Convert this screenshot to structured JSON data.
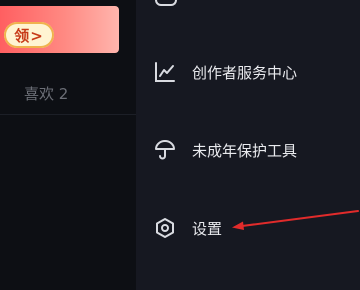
{
  "left_panel": {
    "banner_button_label": "领>",
    "likes_label": "喜欢 2"
  },
  "menu": {
    "items": [
      {
        "label": "创作者服务中心",
        "icon": "chart-icon"
      },
      {
        "label": "未成年保护工具",
        "icon": "umbrella-icon"
      },
      {
        "label": "设置",
        "icon": "settings-hexagon-icon"
      }
    ]
  },
  "colors": {
    "banner_start": "#ff5f61",
    "banner_end": "#ffb5ad",
    "arrow": "#e12b2b",
    "menu_text": "#e9eaee"
  }
}
